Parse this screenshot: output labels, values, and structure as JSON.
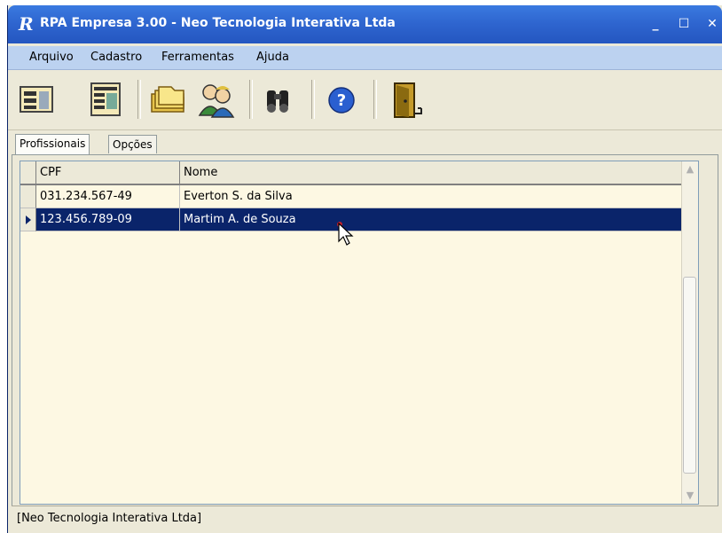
{
  "window": {
    "title": "RPA Empresa 3.00 - Neo Tecnologia Interativa Ltda",
    "app_icon": "R",
    "controls": {
      "minimize": "_",
      "maximize": "☐",
      "close": "✕"
    }
  },
  "menu": [
    "Arquivo",
    "Cadastro",
    "Ferramentas",
    "Ajuda"
  ],
  "toolbar": {
    "buttons": [
      {
        "icon": "form-icon"
      },
      {
        "icon": "form-grid-icon"
      },
      {
        "icon": "folders-icon"
      },
      {
        "icon": "people-icon"
      },
      {
        "icon": "binoculars-icon"
      },
      {
        "icon": "help-icon"
      },
      {
        "icon": "exit-door-icon"
      }
    ]
  },
  "tabs": [
    {
      "label": "Profissionais",
      "active": true
    },
    {
      "label": "Opções",
      "active": false
    }
  ],
  "grid": {
    "columns": [
      "CPF",
      "Nome"
    ],
    "rows": [
      {
        "cpf": "031.234.567-49",
        "nome": "Everton S. da Silva",
        "selected": false
      },
      {
        "cpf": "123.456.789-09",
        "nome": "Martim A. de Souza",
        "selected": true
      }
    ]
  },
  "status": "[Neo Tecnologia Interativa Ltda]",
  "colors": {
    "title_bar": "#2f66d0",
    "menu_bar": "#bcd2f0",
    "grid_bg": "#fdf8e3",
    "selection": "#0a246a"
  }
}
